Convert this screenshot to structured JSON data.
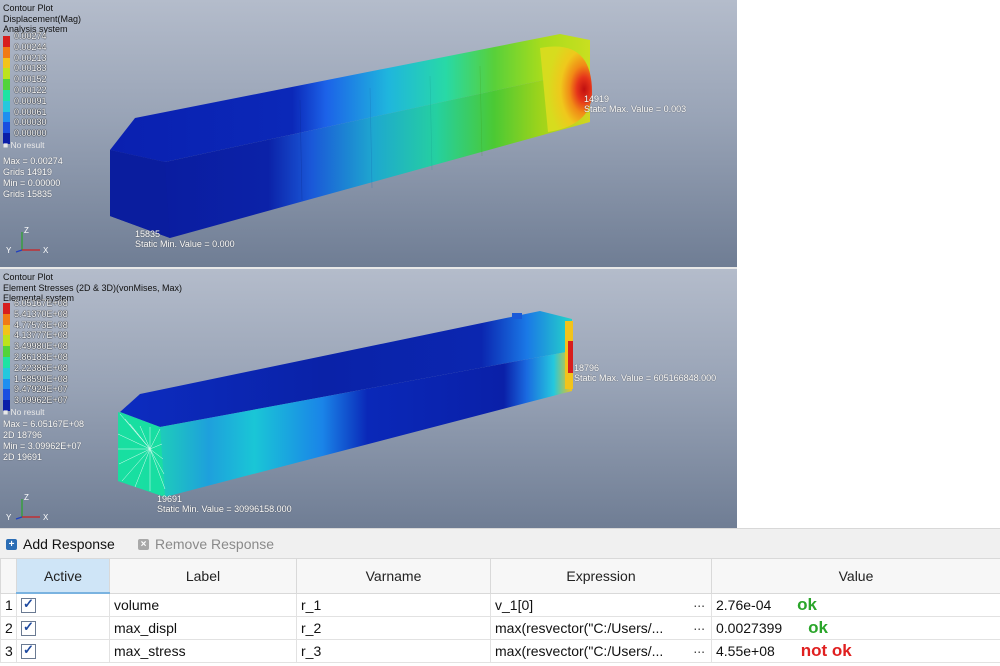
{
  "viewport1": {
    "header": [
      "Contour Plot",
      "Displacement(Mag)",
      "Analysis system"
    ],
    "legend": {
      "values": [
        "0.00274",
        "0.00244",
        "0.00213",
        "0.00183",
        "0.00152",
        "0.00122",
        "0.00091",
        "0.00061",
        "0.00030",
        "0.00000"
      ],
      "colors": [
        "#d71d1d",
        "#f07a14",
        "#f2c31b",
        "#bde21c",
        "#52d33a",
        "#1fe3a3",
        "#25c8dd",
        "#1e8ff0",
        "#1a4fe0",
        "#0a1ea8"
      ],
      "no_result": "No result"
    },
    "stats": [
      "Max = 0.00274",
      "Grids 14919",
      "Min = 0.00000",
      "Grids 15835"
    ],
    "max_anno": [
      "14919",
      "Static Max. Value =  0.003"
    ],
    "min_anno": [
      "15835",
      "Static Min. Value =  0.000"
    ],
    "axes": {
      "y": "Y",
      "z": "Z",
      "x": "X"
    }
  },
  "viewport2": {
    "header": [
      "Contour Plot",
      "Element Stresses (2D & 3D)(vonMises, Max)",
      "Elemental system"
    ],
    "legend": {
      "values": [
        "6.05167E+08",
        "5.41370E+08",
        "4.77573E+08",
        "4.13777E+08",
        "3.49980E+08",
        "2.86183E+08",
        "2.22386E+08",
        "1.58590E+08",
        "9.47929E+07",
        "3.09962E+07"
      ],
      "colors": [
        "#d71d1d",
        "#f07a14",
        "#f2c31b",
        "#bde21c",
        "#52d33a",
        "#1fe3a3",
        "#25c8dd",
        "#1e8ff0",
        "#1a4fe0",
        "#0a1ea8"
      ],
      "no_result": "No result"
    },
    "stats": [
      "Max = 6.05167E+08",
      "2D 18796",
      "Min = 3.09962E+07",
      "2D 19691"
    ],
    "max_anno": [
      "18796",
      "Static Max. Value =  605166848.000"
    ],
    "min_anno": [
      "19691",
      "Static Min. Value =  30996158.000"
    ],
    "axes": {
      "y": "Y",
      "z": "Z",
      "x": "X"
    }
  },
  "toolbar": {
    "add": "Add Response",
    "remove": "Remove Response"
  },
  "table": {
    "headers": {
      "active": "Active",
      "label": "Label",
      "varname": "Varname",
      "expression": "Expression",
      "value": "Value"
    },
    "rows": [
      {
        "idx": "1",
        "label": "volume",
        "varname": "r_1",
        "expression": "v_1[0]",
        "ellipsis": "...",
        "value": "2.76e-04",
        "status": "ok",
        "status_color": "#2aa52a"
      },
      {
        "idx": "2",
        "label": "max_displ",
        "varname": "r_2",
        "expression": "max(resvector(\"C:/Users/...",
        "ellipsis": "...",
        "value": "0.0027399",
        "status": "ok",
        "status_color": "#2aa52a"
      },
      {
        "idx": "3",
        "label": "max_stress",
        "varname": "r_3",
        "expression": "max(resvector(\"C:/Users/...",
        "ellipsis": "...",
        "value": "4.55e+08",
        "status": "not ok",
        "status_color": "#e02020"
      }
    ]
  }
}
